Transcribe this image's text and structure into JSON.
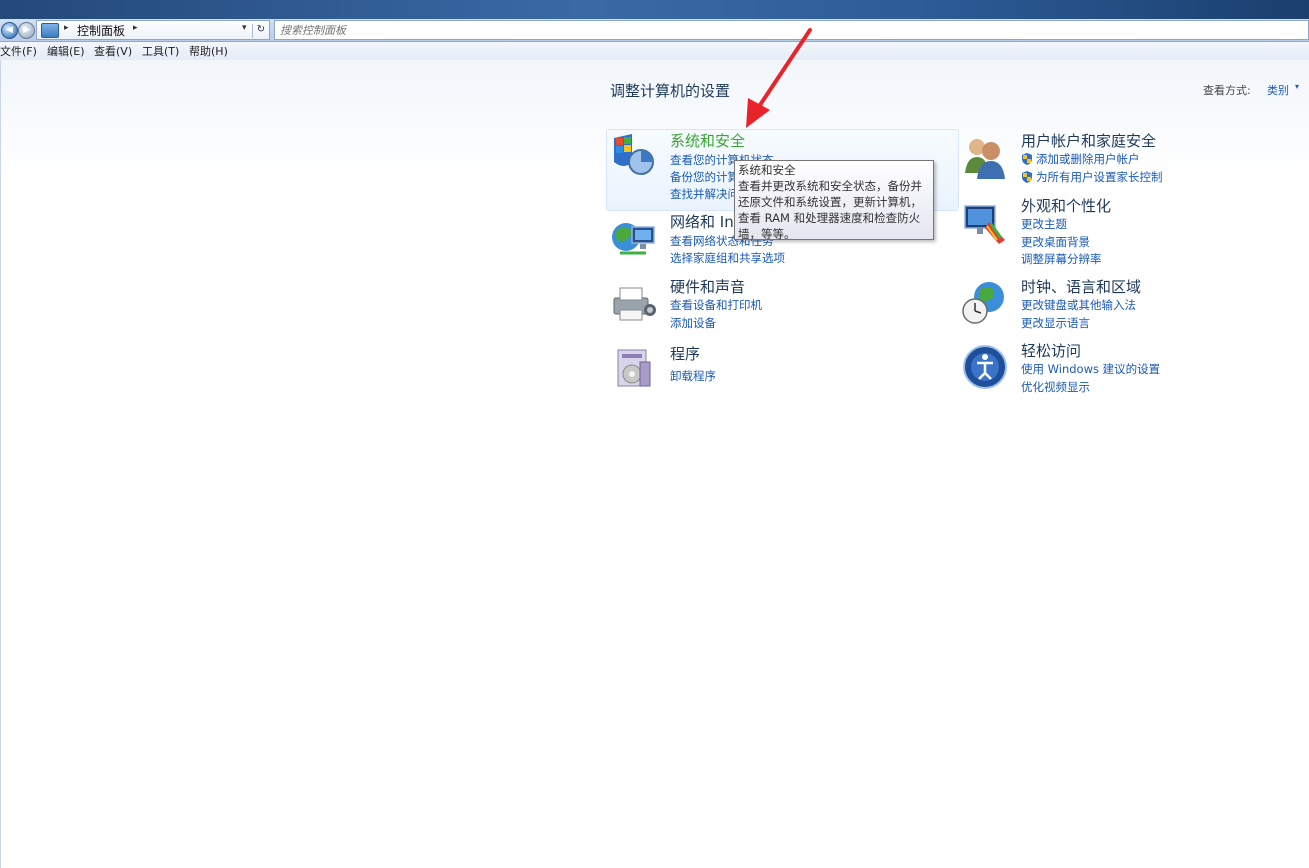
{
  "address_bar": {
    "back_icon": "back-arrow-icon",
    "forward_icon": "forward-arrow-icon",
    "breadcrumb": "控制面板",
    "refresh_icon": "refresh-icon",
    "search_placeholder": "搜索控制面板"
  },
  "menubar": {
    "items": [
      "文件(F)",
      "编辑(E)",
      "查看(V)",
      "工具(T)",
      "帮助(H)"
    ]
  },
  "main": {
    "title": "调整计算机的设置",
    "view_by_label": "查看方式:",
    "view_by_value": "类别"
  },
  "categories": [
    {
      "title": "系统和安全",
      "icon": "system-security-icon",
      "links": [
        "查看您的计算机状态",
        "备份您的计算机",
        "查找并解决问题"
      ]
    },
    {
      "title": "网络和 Internet",
      "icon": "network-icon",
      "links": [
        "查看网络状态和任务",
        "选择家庭组和共享选项"
      ]
    },
    {
      "title": "硬件和声音",
      "icon": "hardware-sound-icon",
      "links": [
        "查看设备和打印机",
        "添加设备"
      ]
    },
    {
      "title": "程序",
      "icon": "programs-icon",
      "links": [
        "卸载程序"
      ]
    },
    {
      "title": "用户帐户和家庭安全",
      "icon": "user-accounts-icon",
      "links": [
        "添加或删除用户帐户",
        "为所有用户设置家长控制"
      ]
    },
    {
      "title": "外观和个性化",
      "icon": "appearance-icon",
      "links": [
        "更改主题",
        "更改桌面背景",
        "调整屏幕分辨率"
      ]
    },
    {
      "title": "时钟、语言和区域",
      "icon": "clock-language-icon",
      "links": [
        "更改键盘或其他输入法",
        "更改显示语言"
      ]
    },
    {
      "title": "轻松访问",
      "icon": "ease-of-access-icon",
      "links": [
        "使用 Windows 建议的设置",
        "优化视频显示"
      ]
    }
  ],
  "tooltip": {
    "lines": [
      "系统和安全",
      "查看并更改系统和安全状态，备份并",
      "还原文件和系统设置，更新计算机，",
      "查看 RAM 和处理器速度和检查防火",
      "墙，等等。"
    ]
  },
  "colors": {
    "link": "#1a5ab8",
    "heading": "#1e395b",
    "hover_heading": "#3aa635",
    "annotation_arrow": "#e8242a"
  }
}
